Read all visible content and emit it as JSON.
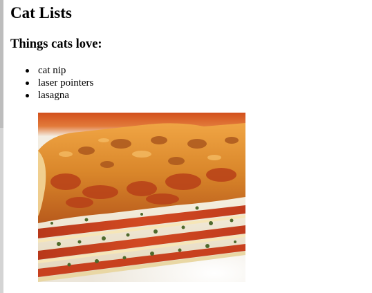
{
  "page": {
    "title": "Cat Lists",
    "subtitle": "Things cats love:",
    "items": [
      "cat nip",
      "laser pointers",
      "lasagna"
    ]
  },
  "image": {
    "subject": "lasagna",
    "colors": {
      "plate": "#f4f1ea",
      "cheese_top": "#e0902c",
      "sauce": "#c8401e",
      "ricotta": "#f2ecdc",
      "spinach": "#4f6a2c"
    }
  }
}
